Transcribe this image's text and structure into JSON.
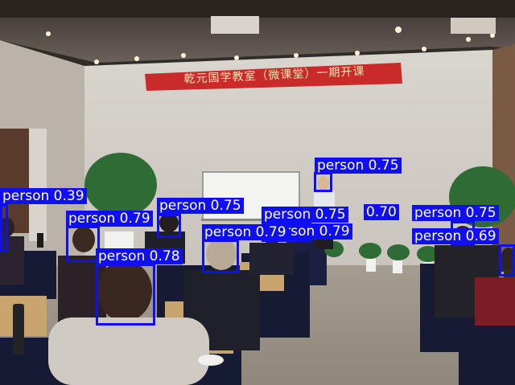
{
  "banner": {
    "text": "乾元国学教室（微课堂）一期开课"
  },
  "colors": {
    "box": "#1010ee",
    "label_text": "#ffffff",
    "banner": "#c92a2a"
  },
  "detections": [
    {
      "id": "speaker",
      "class": "person",
      "score": "0.75",
      "label": "person 0.75"
    },
    {
      "id": "left-edge",
      "class": "person",
      "score": "0.39",
      "label": "person 0.39"
    },
    {
      "id": "mid-left",
      "class": "person",
      "score": "0.75",
      "label": "person 0.75"
    },
    {
      "id": "woman-left",
      "class": "person",
      "score": "0.79",
      "label": "person 0.79"
    },
    {
      "id": "center",
      "class": "person",
      "score": "0.75",
      "label": "person 0.75"
    },
    {
      "id": "center-2",
      "class": "person",
      "score": "0.79",
      "label": "person 0.79"
    },
    {
      "id": "center-3",
      "class": "person",
      "score": "0.70",
      "label": "0.70"
    },
    {
      "id": "cap-person",
      "class": "person",
      "score": "0.79",
      "label": "person 0.79"
    },
    {
      "id": "front-woman",
      "class": "person",
      "score": "0.78",
      "label": "person 0.78"
    },
    {
      "id": "right-back",
      "class": "person",
      "score": "0.75",
      "label": "person 0.75"
    },
    {
      "id": "right-mid",
      "class": "person",
      "score": "0.69",
      "label": "person 0.69"
    }
  ]
}
